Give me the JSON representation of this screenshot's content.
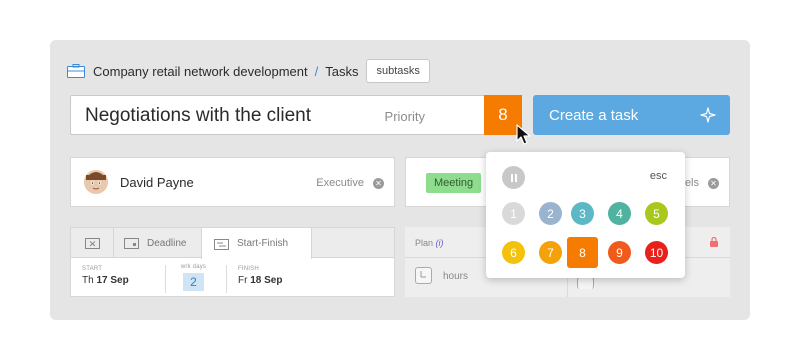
{
  "breadcrumb": {
    "project": "Company retail network development",
    "separator": "/",
    "current": "Tasks",
    "subtasks_button": "subtasks"
  },
  "task": {
    "title": "Negotiations with the client",
    "priority_label": "Priority",
    "priority_value": "8"
  },
  "create_button": {
    "label": "Create a task",
    "icon": "sparkle-icon"
  },
  "executive": {
    "name": "David Payne",
    "role": "Executive"
  },
  "meeting": {
    "tag": "Meeting",
    "labels_text": "els"
  },
  "tabs": {
    "items": [
      {
        "label": "",
        "icon": "close-calendar-icon"
      },
      {
        "label": "Deadline",
        "icon": "calendar-icon"
      },
      {
        "label": "Start-Finish",
        "icon": "timeline-icon"
      }
    ],
    "active_index": 2
  },
  "schedule": {
    "start_caption": "START",
    "start_day": "Th",
    "start_date": "17 Sep",
    "workdays_caption": "wrk days",
    "workdays_value": "2",
    "finish_caption": "FINISH",
    "finish_day": "Fr",
    "finish_date": "18 Sep"
  },
  "plan": {
    "label": "Plan",
    "info": "(i)",
    "hours": "hours"
  },
  "priority_popup": {
    "esc_label": "esc",
    "selected": "8",
    "options": [
      {
        "value": "1",
        "color": "#d9d9d9"
      },
      {
        "value": "2",
        "color": "#9ab3cf"
      },
      {
        "value": "3",
        "color": "#5cb8c4"
      },
      {
        "value": "4",
        "color": "#4fb3a0"
      },
      {
        "value": "5",
        "color": "#a8c81e"
      },
      {
        "value": "6",
        "color": "#f4c20d"
      },
      {
        "value": "7",
        "color": "#f5a10a"
      },
      {
        "value": "8",
        "color": "#f57c00"
      },
      {
        "value": "9",
        "color": "#f05a1a"
      },
      {
        "value": "10",
        "color": "#e8221b"
      }
    ]
  },
  "colors": {
    "accent": "#5ba9e0",
    "priority": "#f57c00",
    "meeting_tag": "#8fdc8f"
  }
}
